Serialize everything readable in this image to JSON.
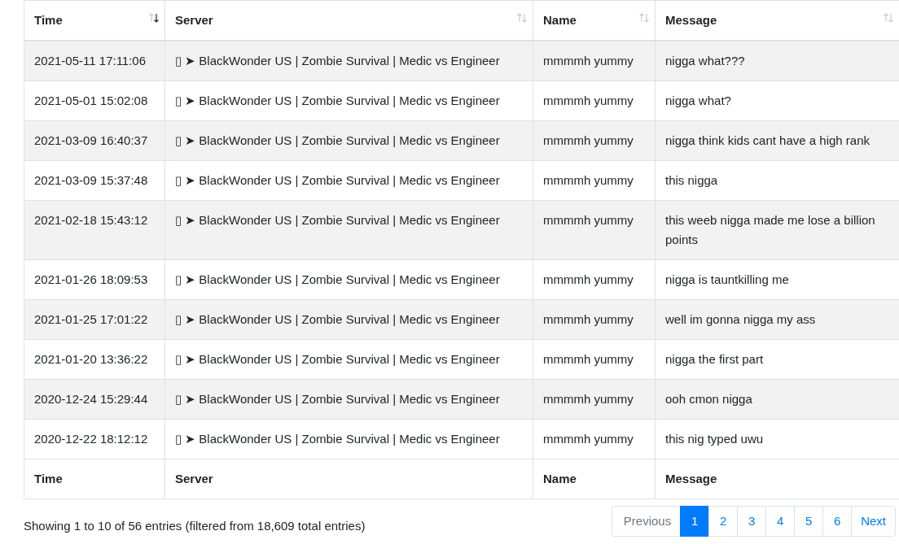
{
  "table": {
    "columns": [
      {
        "label": "Time",
        "sorted": true
      },
      {
        "label": "Server",
        "sorted": false
      },
      {
        "label": "Name",
        "sorted": false
      },
      {
        "label": "Message",
        "sorted": false
      }
    ],
    "rows": [
      [
        "2021-05-11 17:11:06",
        "▯ ➤ BlackWonder US | Zombie Survival | Medic vs Engineer",
        "mmmmh yummy",
        "nigga what???"
      ],
      [
        "2021-05-01 15:02:08",
        "▯ ➤ BlackWonder US | Zombie Survival | Medic vs Engineer",
        "mmmmh yummy",
        "nigga what?"
      ],
      [
        "2021-03-09 16:40:37",
        "▯ ➤ BlackWonder US | Zombie Survival | Medic vs Engineer",
        "mmmmh yummy",
        "nigga think kids cant have a high rank"
      ],
      [
        "2021-03-09 15:37:48",
        "▯ ➤ BlackWonder US | Zombie Survival | Medic vs Engineer",
        "mmmmh yummy",
        "this nigga"
      ],
      [
        "2021-02-18 15:43:12",
        "▯ ➤ BlackWonder US | Zombie Survival | Medic vs Engineer",
        "mmmmh yummy",
        "this weeb nigga made me lose a billion points"
      ],
      [
        "2021-01-26 18:09:53",
        "▯ ➤ BlackWonder US | Zombie Survival | Medic vs Engineer",
        "mmmmh yummy",
        "nigga is tauntkilling me"
      ],
      [
        "2021-01-25 17:01:22",
        "▯ ➤ BlackWonder US | Zombie Survival | Medic vs Engineer",
        "mmmmh yummy",
        "well im gonna nigga my ass"
      ],
      [
        "2021-01-20 13:36:22",
        "▯ ➤ BlackWonder US | Zombie Survival | Medic vs Engineer",
        "mmmmh yummy",
        "nigga the first part"
      ],
      [
        "2020-12-24 15:29:44",
        "▯ ➤ BlackWonder US | Zombie Survival | Medic vs Engineer",
        "mmmmh yummy",
        "ooh cmon nigga"
      ],
      [
        "2020-12-22 18:12:12",
        "▯ ➤ BlackWonder US | Zombie Survival | Medic vs Engineer",
        "mmmmh yummy",
        "this nig typed uwu"
      ]
    ],
    "footer": [
      "Time",
      "Server",
      "Name",
      "Message"
    ]
  },
  "info": "Showing 1 to 10 of 56 entries (filtered from 18,609 total entries)",
  "pagination": [
    {
      "label": "Previous",
      "kind": "nav",
      "disabled": true,
      "selected": false
    },
    {
      "label": "1",
      "kind": "page",
      "disabled": false,
      "selected": true
    },
    {
      "label": "2",
      "kind": "page",
      "disabled": false,
      "selected": false
    },
    {
      "label": "3",
      "kind": "page",
      "disabled": false,
      "selected": false
    },
    {
      "label": "4",
      "kind": "page",
      "disabled": false,
      "selected": false
    },
    {
      "label": "5",
      "kind": "page",
      "disabled": false,
      "selected": false
    },
    {
      "label": "6",
      "kind": "page",
      "disabled": false,
      "selected": false
    },
    {
      "label": "Next",
      "kind": "nav",
      "disabled": false,
      "selected": false
    }
  ]
}
